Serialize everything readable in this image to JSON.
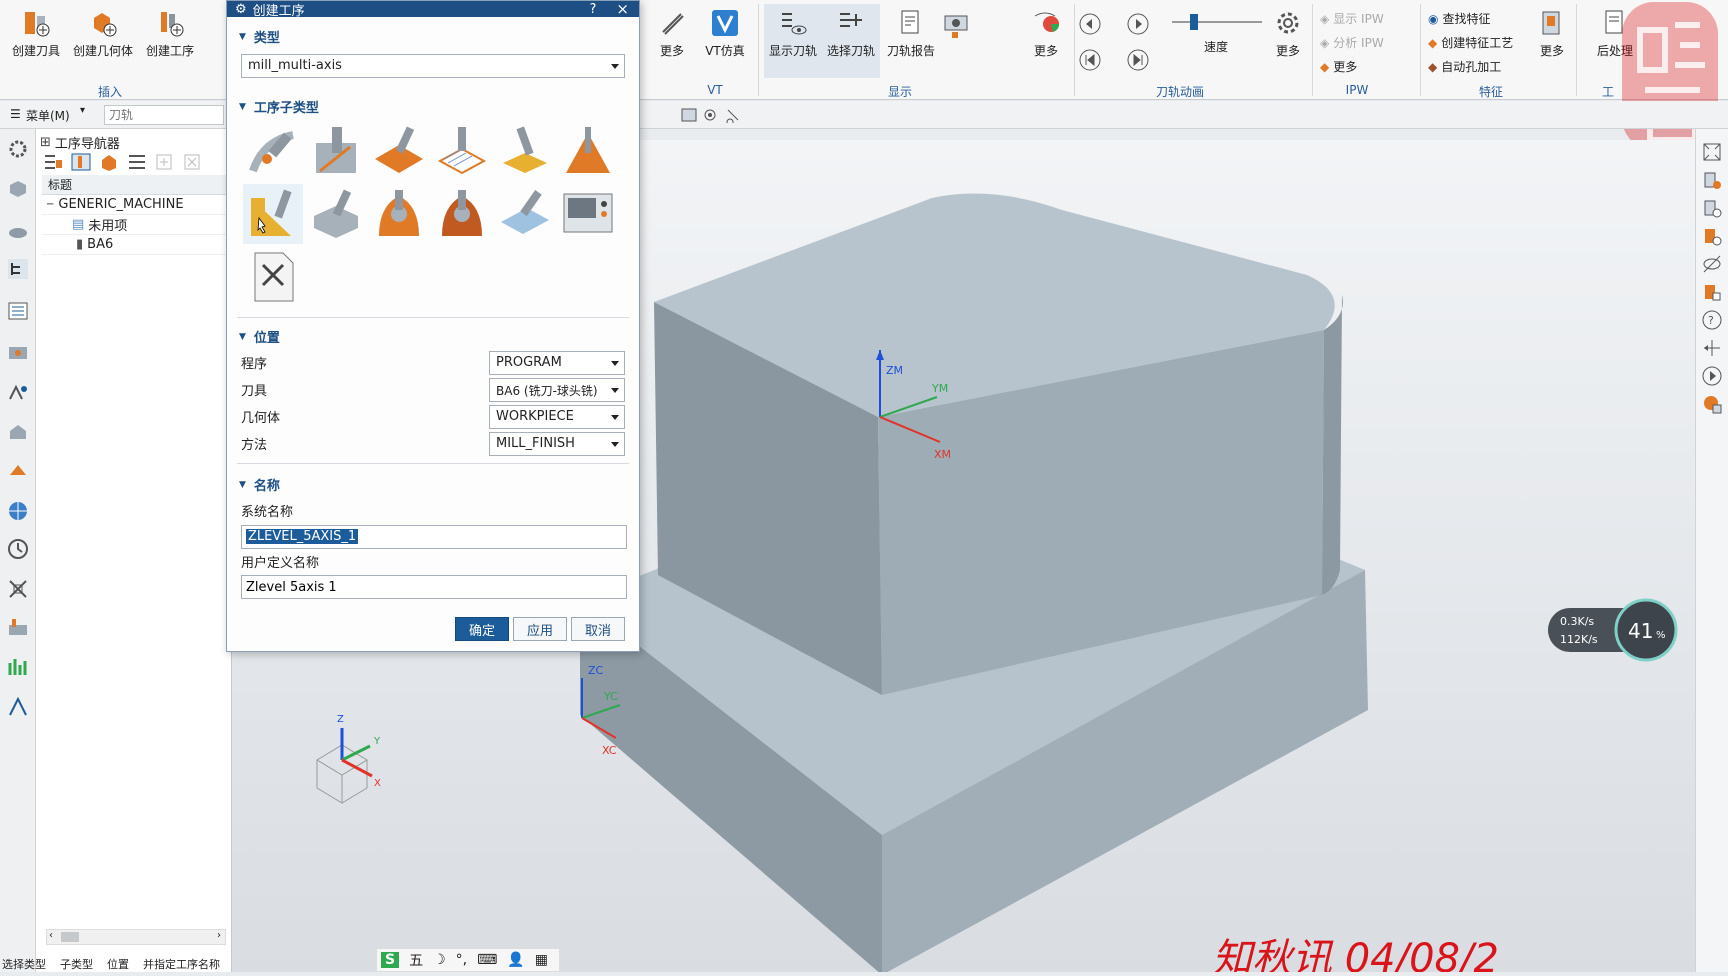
{
  "ribbon": {
    "insert_group": {
      "label": "插入",
      "buttons": [
        "创建刀具",
        "创建几何体",
        "创建工序"
      ]
    },
    "more_label": "更多",
    "vt": {
      "button": "VT仿真",
      "group": "VT"
    },
    "display": {
      "group": "显示",
      "buttons": [
        "显示刀轨",
        "选择刀轨",
        "刀轨报告"
      ],
      "more": "更多"
    },
    "animation": {
      "group": "刀轨动画",
      "speed_label": "速度",
      "more": "更多"
    },
    "ipw": {
      "group": "IPW",
      "items": [
        "显示 IPW",
        "分析 IPW",
        "更多"
      ]
    },
    "feature": {
      "group": "特征",
      "items": [
        "查找特征",
        "创建特征工艺",
        "自动孔加工"
      ],
      "more": "更多"
    },
    "tools": {
      "group": "工",
      "button": "后处理"
    }
  },
  "toolbar2": {
    "menu_label": "菜单(M)",
    "search_placeholder": "刀轨"
  },
  "navigator": {
    "title": "工序导航器",
    "column_header": "标题",
    "tree": [
      {
        "label": "GENERIC_MACHINE",
        "level": 0
      },
      {
        "label": "未用项",
        "level": 1
      },
      {
        "label": "BA6",
        "level": 1
      }
    ]
  },
  "dialog": {
    "title": "创建工序",
    "help": "?",
    "close": "×",
    "type_section": "类型",
    "type_value": "mill_multi-axis",
    "subtype_section": "工序子类型",
    "location_section": "位置",
    "location": [
      {
        "label": "程序",
        "value": "PROGRAM"
      },
      {
        "label": "刀具",
        "value": "BA6 (铣刀-球头铣)"
      },
      {
        "label": "几何体",
        "value": "WORKPIECE"
      },
      {
        "label": "方法",
        "value": "MILL_FINISH"
      }
    ],
    "name_section": "名称",
    "system_name_label": "系统名称",
    "system_name_value": "ZLEVEL_5AXIS_1",
    "user_name_label": "用户定义名称",
    "user_name_value": "Zlevel 5axis 1",
    "ok": "确定",
    "apply": "应用",
    "cancel": "取消"
  },
  "viewport": {
    "axes": {
      "zm": "ZM",
      "ym": "YM",
      "xm": "XM",
      "zc": "ZC",
      "yc": "YC",
      "xc": "XC",
      "z": "Z",
      "y": "Y",
      "x": "X"
    },
    "net_monitor": {
      "up": "0.3K/s",
      "down": "112K/s",
      "percent": "41"
    },
    "watermark_text": "知秋讯 04/08/2"
  },
  "statusbar": [
    "选择类型",
    "子类型",
    "位置",
    "并指定工序名称"
  ],
  "ime": {
    "items": [
      "S",
      "五",
      "☽",
      "°,",
      "⌨",
      "👤",
      "▦"
    ]
  },
  "colors": {
    "accent": "#1d4f84",
    "part": "#a9b8c2",
    "orange": "#e07a26",
    "watermark": "#d9141a"
  }
}
